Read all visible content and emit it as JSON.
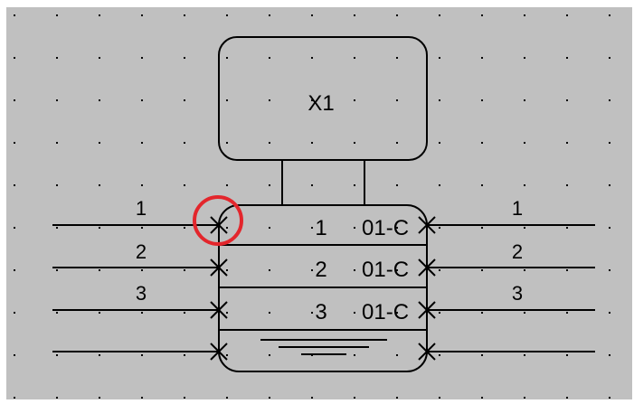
{
  "colors": {
    "canvas_bg": "#c0c0c0",
    "window_bg": "#ffffff",
    "line": "#000000",
    "grid_dot": "#000000",
    "highlight": "#e3262c"
  },
  "component": {
    "label": "X1"
  },
  "rows": [
    {
      "number": "1",
      "pin": "01-C",
      "left_wire": "1",
      "right_wire": "1"
    },
    {
      "number": "2",
      "pin": "01-C",
      "left_wire": "2",
      "right_wire": "2"
    },
    {
      "number": "3",
      "pin": "01-C",
      "left_wire": "3",
      "right_wire": "3"
    }
  ],
  "icons": {
    "connection_marker": "x-mark-icon",
    "ground": "ground-icon",
    "selection": "selection-circle-icon"
  }
}
